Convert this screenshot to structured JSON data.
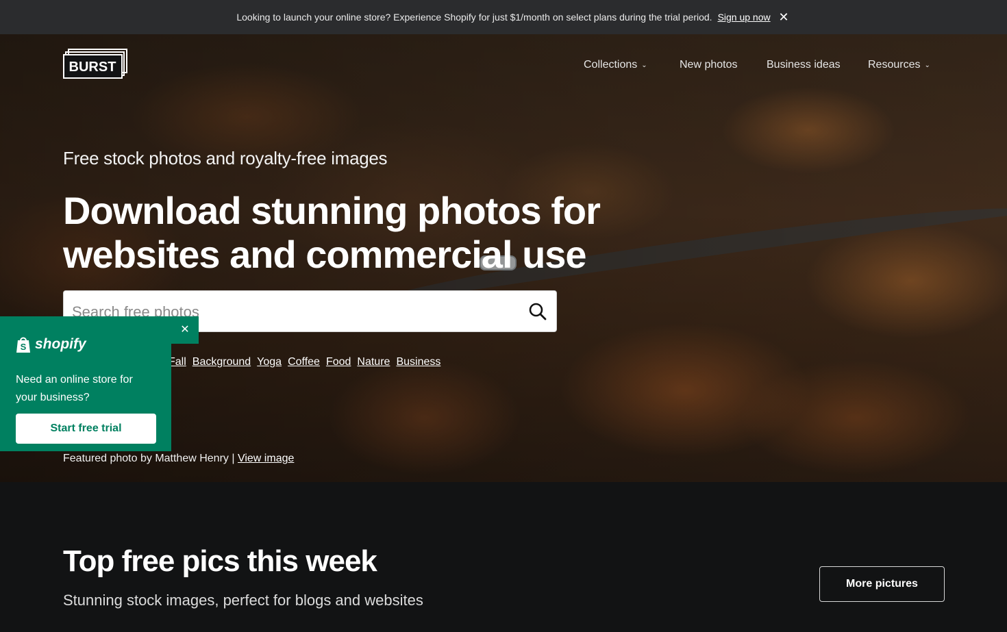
{
  "announcement": {
    "text": "Looking to launch your online store? Experience Shopify for just $1/month on select plans during the trial period.",
    "link_label": "Sign up now",
    "close_icon": "close-icon"
  },
  "header": {
    "logo_text": "BURST",
    "nav": [
      {
        "label": "Collections",
        "has_dropdown": true
      },
      {
        "label": "New photos",
        "has_dropdown": false
      },
      {
        "label": "Business ideas",
        "has_dropdown": false
      },
      {
        "label": "Resources",
        "has_dropdown": true
      }
    ]
  },
  "hero": {
    "kicker": "Free stock photos and royalty-free images",
    "headline": "Download stunning photos for websites and commercial use",
    "search": {
      "placeholder": "Search free photos",
      "icon": "search-icon"
    },
    "tags": [
      "Fall",
      "Background",
      "Yoga",
      "Coffee",
      "Food",
      "Nature",
      "Business"
    ],
    "credit_text": "Featured photo by Matthew Henry |",
    "credit_link": "View image"
  },
  "popup": {
    "brand": "shopify",
    "message": "Need an online store for your business?",
    "cta": "Start free trial",
    "accent": "#008060"
  },
  "section": {
    "title": "Top free pics this week",
    "subtitle": "Stunning stock images, perfect for blogs and websites",
    "button": "More pictures"
  }
}
